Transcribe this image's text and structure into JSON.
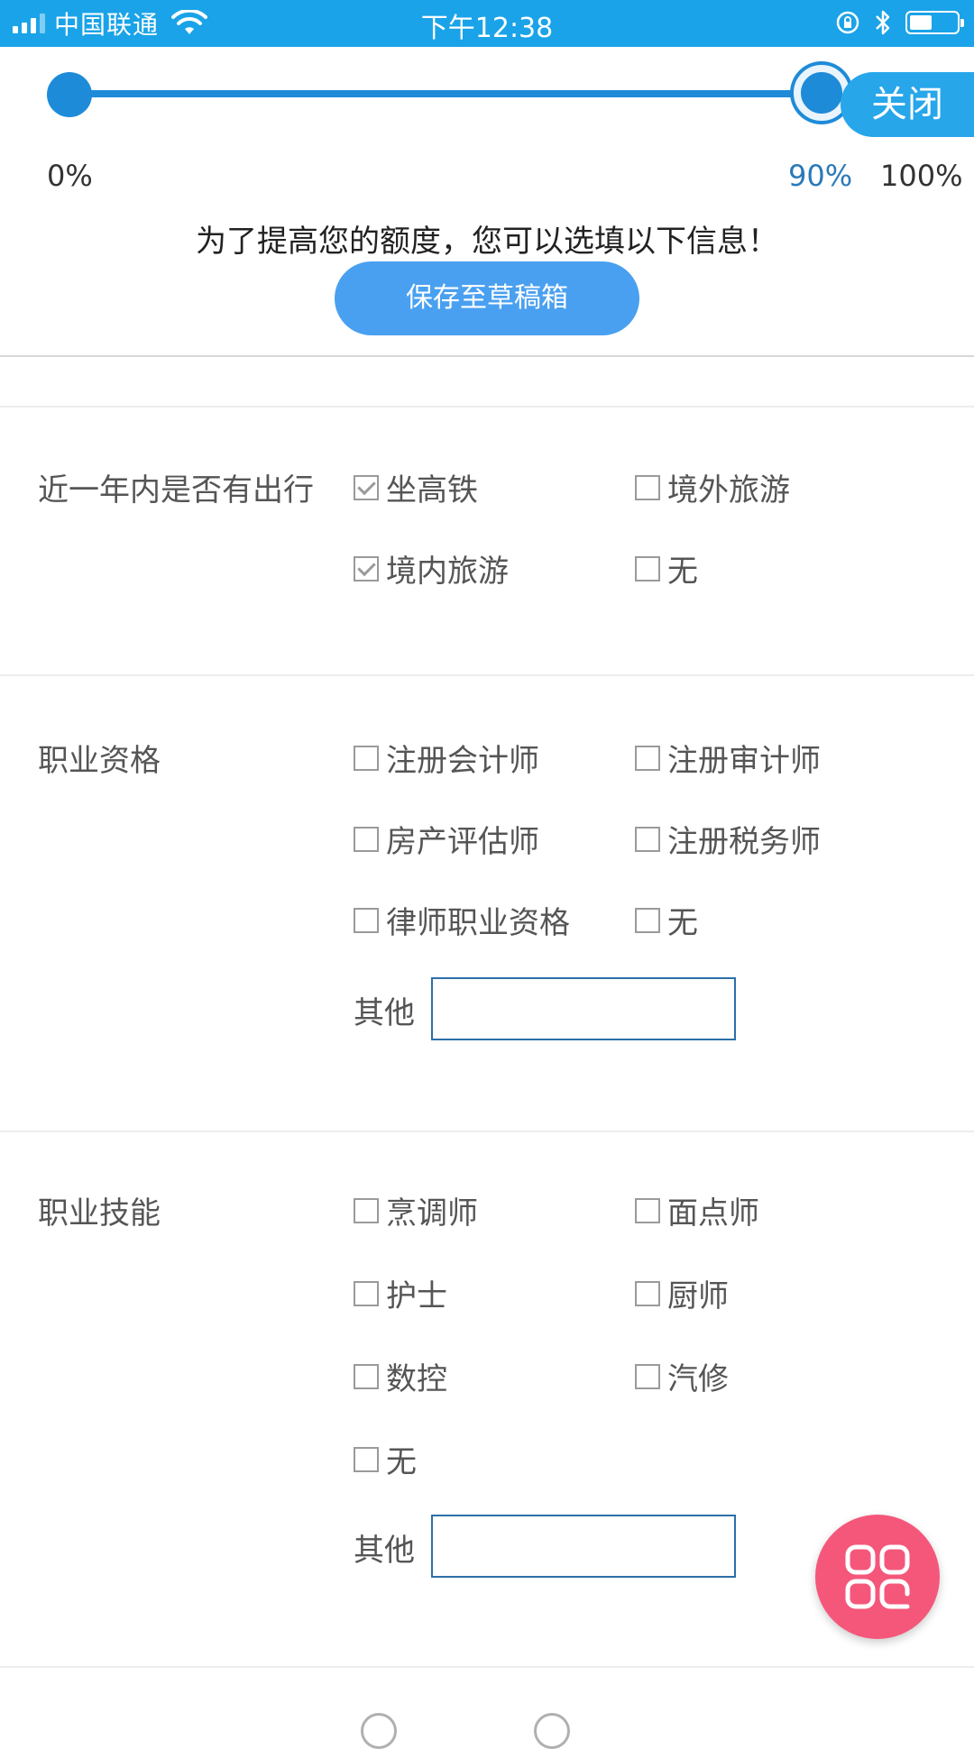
{
  "status_bar": {
    "carrier": "中国联通",
    "time": "下午12:38",
    "battery_level": 0.55
  },
  "progress": {
    "value_percent": 90,
    "min_label": "0%",
    "current_label": "90%",
    "max_label": "100%",
    "close_label": "关闭"
  },
  "hint": "为了提高您的额度，您可以选填以下信息！",
  "save_button": "保存至草稿箱",
  "sections": {
    "travel": {
      "label": "近一年内是否有出行",
      "options": [
        {
          "label": "坐高铁",
          "checked": true
        },
        {
          "label": "境外旅游",
          "checked": false
        },
        {
          "label": "境内旅游",
          "checked": true
        },
        {
          "label": "无",
          "checked": false
        }
      ]
    },
    "qualification": {
      "label": "职业资格",
      "options": [
        {
          "label": "注册会计师",
          "checked": false
        },
        {
          "label": "注册审计师",
          "checked": false
        },
        {
          "label": "房产评估师",
          "checked": false
        },
        {
          "label": "注册税务师",
          "checked": false
        },
        {
          "label": "律师职业资格",
          "checked": false
        },
        {
          "label": "无",
          "checked": false
        }
      ],
      "other_label": "其他",
      "other_value": ""
    },
    "skills": {
      "label": "职业技能",
      "options": [
        {
          "label": "烹调师",
          "checked": false
        },
        {
          "label": "面点师",
          "checked": false
        },
        {
          "label": "护士",
          "checked": false
        },
        {
          "label": "厨师",
          "checked": false
        },
        {
          "label": "数控",
          "checked": false
        },
        {
          "label": "汽修",
          "checked": false
        },
        {
          "label": "无",
          "checked": false
        }
      ],
      "other_label": "其他",
      "other_value": ""
    }
  },
  "icons": {
    "fab": "apps-grid-icon"
  }
}
